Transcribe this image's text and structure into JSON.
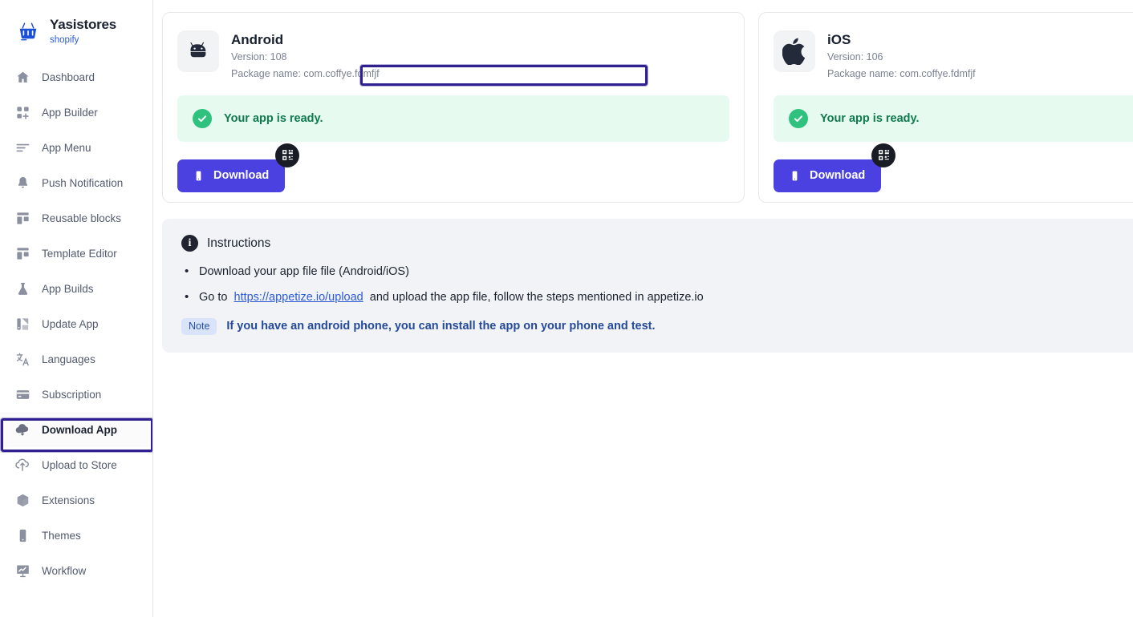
{
  "sidebar": {
    "brand": {
      "name": "Yasistores",
      "platform": "shopify",
      "logo_icon": "shopping-basket-icon"
    },
    "items": [
      {
        "label": "Dashboard",
        "icon": "home-icon",
        "active": false
      },
      {
        "label": "App Builder",
        "icon": "grid-plus-icon",
        "active": false
      },
      {
        "label": "App Menu",
        "icon": "menu-lines-icon",
        "active": false
      },
      {
        "label": "Push Notification",
        "icon": "bell-icon",
        "active": false
      },
      {
        "label": "Reusable blocks",
        "icon": "blocks-icon",
        "active": false
      },
      {
        "label": "Template Editor",
        "icon": "layout-icon",
        "active": false
      },
      {
        "label": "App Builds",
        "icon": "flask-icon",
        "active": false
      },
      {
        "label": "Update App",
        "icon": "update-chart-icon",
        "active": false
      },
      {
        "label": "Languages",
        "icon": "translate-icon",
        "active": false
      },
      {
        "label": "Subscription",
        "icon": "credit-card-icon",
        "active": false
      },
      {
        "label": "Download App",
        "icon": "cloud-download-icon",
        "active": true
      },
      {
        "label": "Upload to Store",
        "icon": "cloud-upload-icon",
        "active": false
      },
      {
        "label": "Extensions",
        "icon": "cube-icon",
        "active": false
      },
      {
        "label": "Themes",
        "icon": "phone-icon",
        "active": false
      },
      {
        "label": "Workflow",
        "icon": "workflow-chart-icon",
        "active": false
      }
    ]
  },
  "cards": {
    "android": {
      "platform_icon": "android-icon",
      "name": "Android",
      "version": "Version: 108",
      "package": "Package name: com.coffye.fdmfjf",
      "status": "Your app is ready.",
      "download_label": "Download",
      "download_icon": "mobile-icon",
      "qr_icon": "qr-code-icon"
    },
    "ios": {
      "platform_icon": "apple-icon",
      "name": "iOS",
      "version": "Version: 106",
      "package": "Package name: com.coffye.fdmfjf",
      "status": "Your app is ready.",
      "download_label": "Download",
      "download_icon": "mobile-icon",
      "qr_icon": "qr-code-icon"
    }
  },
  "instructions": {
    "icon": "info-icon",
    "title": "Instructions",
    "bullets": [
      {
        "before": "Download your app file file (Android/iOS)",
        "link": "",
        "after": ""
      },
      {
        "before": "Go to",
        "link": "https://appetize.io/upload",
        "after": "and upload the app file, follow the steps mentioned in appetize.io"
      }
    ],
    "note_chip": "Note",
    "note_text": "If you have an android phone, you can install the app on your phone and test."
  },
  "colors": {
    "accent": "#4b41e0",
    "brand_link": "#2d5bd6",
    "success_bg": "#e7faf0",
    "success_fg": "#0f7a4d",
    "annotation": "#2f1f8f",
    "panel_bg": "#f1f3f6"
  }
}
